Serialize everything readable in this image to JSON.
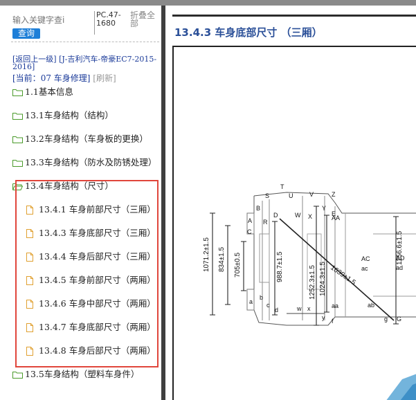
{
  "search": {
    "placeholder": "输入关键字查i",
    "button_label": "查询"
  },
  "vehicle_code": "PC.47-1680",
  "collapse_all_label": "折叠全部",
  "breadcrumb": {
    "back_label": "[返回上一级]",
    "path_label": "[J-吉利汽车-帝豪EC7-2015-2016]",
    "current_prefix": "[当前：",
    "current_value": "07 车身修理]",
    "refresh_label": "[刷新]"
  },
  "tree": {
    "items": [
      {
        "num": "1.1",
        "text": "基本信息"
      },
      {
        "num": "13.1",
        "text": "车身结构（结构）"
      },
      {
        "num": "13.2",
        "text": "车身结构（车身板的更换）"
      },
      {
        "num": "13.3",
        "text": "车身结构（防水及防锈处理）"
      },
      {
        "num": "13.4",
        "text": "车身结构（尺寸）"
      },
      {
        "num": "13.5",
        "text": "车身结构（塑料车身件）"
      }
    ],
    "children": [
      {
        "num": "13.4.1",
        "text": "车身前部尺寸（三厢）"
      },
      {
        "num": "13.4.3",
        "text": "车身底部尺寸（三厢）"
      },
      {
        "num": "13.4.4",
        "text": "车身后部尺寸（三厢）"
      },
      {
        "num": "13.4.5",
        "text": "车身前部尺寸（两厢）"
      },
      {
        "num": "13.4.6",
        "text": "车身中部尺寸（两厢）"
      },
      {
        "num": "13.4.7",
        "text": "车身底部尺寸（两厢）"
      },
      {
        "num": "13.4.8",
        "text": "车身后部尺寸（两厢）"
      }
    ]
  },
  "document": {
    "title": "13.4.3 车身底部尺寸 （三厢）",
    "dimensions": [
      "1071.2±1.5",
      "834±1.5",
      "705±0.5",
      "988.7±1.5",
      "1252.3±1.5",
      "1024.3±1.5",
      "1639±1.5",
      "1156.6±1.5"
    ],
    "point_labels": [
      "T",
      "S",
      "U",
      "V",
      "Z",
      "Y",
      "E",
      "B",
      "A",
      "R",
      "D",
      "W",
      "X",
      "AA",
      "C",
      "AC",
      "AD",
      "ad",
      "ac",
      "a",
      "b",
      "c",
      "d",
      "w",
      "x",
      "aa",
      "ab",
      "y",
      "f",
      "g",
      "G"
    ]
  },
  "colors": {
    "link": "#1a3a99",
    "button": "#1e7fd8",
    "highlight": "#e0453b",
    "doc_title": "#2a4f98",
    "folder": "#4a9a2a",
    "doc_file": "#e0a030"
  }
}
